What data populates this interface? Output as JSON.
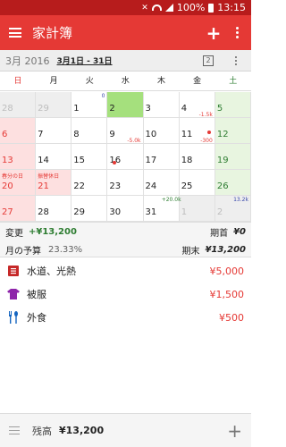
{
  "status": {
    "battery": "100%",
    "time": "13:15"
  },
  "appbar": {
    "title": "家計簿"
  },
  "monthbar": {
    "month": "3月 2016",
    "range": "3月1日 - 31日",
    "view_badge": "2"
  },
  "weekdays": [
    "日",
    "月",
    "火",
    "水",
    "木",
    "金",
    "土"
  ],
  "calendar": {
    "days": [
      "28",
      "29",
      "1",
      "2",
      "3",
      "4",
      "5",
      "6",
      "7",
      "8",
      "9",
      "10",
      "11",
      "12",
      "13",
      "14",
      "15",
      "16",
      "17",
      "18",
      "19",
      "20",
      "21",
      "22",
      "23",
      "24",
      "25",
      "26",
      "27",
      "28",
      "29",
      "30",
      "31",
      "1",
      "2"
    ],
    "notes": {
      "spring_equinox": "春分の日",
      "substitute_holiday": "振替休日"
    },
    "amounts": {
      "d2_top": "0",
      "d5_mid": "-1.5k",
      "d12_top": "-300",
      "d10_mid": "-5.0k",
      "d1_top": "+20.0k",
      "d2_top2": "13.2k"
    }
  },
  "summary": {
    "change_label": "変更",
    "change_value": "+¥13,200",
    "start_label": "期首",
    "start_value": "¥0",
    "budget_label": "月の予算",
    "budget_rate": "23.33%",
    "end_label": "期末",
    "end_value": "¥13,200"
  },
  "categories": [
    {
      "name": "水道、光熱",
      "value": "¥5,000",
      "icon": "utilities-icon",
      "color": "#c62828"
    },
    {
      "name": "被服",
      "value": "¥1,500",
      "icon": "clothing-icon",
      "color": "#8e24aa"
    },
    {
      "name": "外食",
      "value": "¥500",
      "icon": "dining-icon",
      "color": "#1565c0"
    }
  ],
  "bottom": {
    "balance_label": "残高",
    "balance_value": "¥13,200"
  },
  "colors": {
    "accent": "#e53935",
    "sunday": "#e53935",
    "saturday": "#2e7d32",
    "today_bg": "#a5e07d",
    "weekend_sat_bg": "#e8f5e0",
    "holiday_bg": "#fde0e0"
  }
}
